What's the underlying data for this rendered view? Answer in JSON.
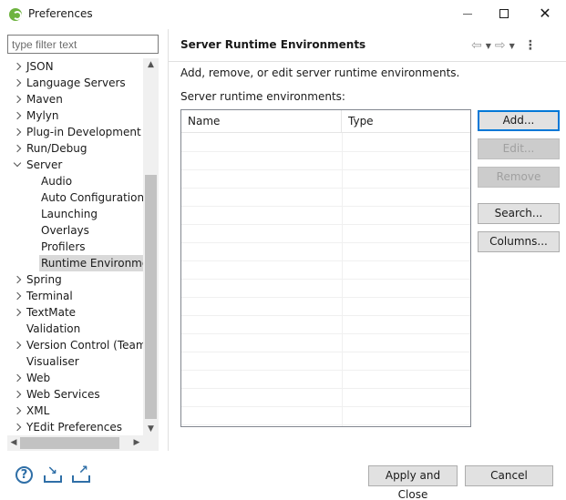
{
  "window": {
    "title": "Preferences",
    "minimize_label": "",
    "maximize_label": "",
    "close_label": "✕"
  },
  "sidebar": {
    "filter_placeholder": "type filter text",
    "items": [
      {
        "label": "JSON",
        "twisty": "collapsed",
        "level": 0
      },
      {
        "label": "Language Servers",
        "twisty": "collapsed",
        "level": 0
      },
      {
        "label": "Maven",
        "twisty": "collapsed",
        "level": 0
      },
      {
        "label": "Mylyn",
        "twisty": "collapsed",
        "level": 0
      },
      {
        "label": "Plug-in Development",
        "twisty": "collapsed",
        "level": 0
      },
      {
        "label": "Run/Debug",
        "twisty": "collapsed",
        "level": 0
      },
      {
        "label": "Server",
        "twisty": "expanded",
        "level": 0
      },
      {
        "label": "Audio",
        "twisty": "none",
        "level": 1
      },
      {
        "label": "Auto Configuration",
        "twisty": "none",
        "level": 1
      },
      {
        "label": "Launching",
        "twisty": "none",
        "level": 1
      },
      {
        "label": "Overlays",
        "twisty": "none",
        "level": 1
      },
      {
        "label": "Profilers",
        "twisty": "none",
        "level": 1
      },
      {
        "label": "Runtime Environmen",
        "twisty": "none",
        "level": 1,
        "selected": true
      },
      {
        "label": "Spring",
        "twisty": "collapsed",
        "level": 0
      },
      {
        "label": "Terminal",
        "twisty": "collapsed",
        "level": 0
      },
      {
        "label": "TextMate",
        "twisty": "collapsed",
        "level": 0
      },
      {
        "label": "Validation",
        "twisty": "none",
        "level": 0
      },
      {
        "label": "Version Control (Team)",
        "twisty": "collapsed",
        "level": 0
      },
      {
        "label": "Visualiser",
        "twisty": "none",
        "level": 0
      },
      {
        "label": "Web",
        "twisty": "collapsed",
        "level": 0
      },
      {
        "label": "Web Services",
        "twisty": "collapsed",
        "level": 0
      },
      {
        "label": "XML",
        "twisty": "collapsed",
        "level": 0
      },
      {
        "label": "YEdit Preferences",
        "twisty": "collapsed",
        "level": 0
      }
    ]
  },
  "page": {
    "title": "Server Runtime Environments",
    "description": "Add, remove, or edit server runtime environments.",
    "table_label": "Server runtime environments:",
    "table": {
      "columns": [
        "Name",
        "Type"
      ],
      "rows": []
    },
    "buttons": {
      "add": "Add...",
      "edit": "Edit...",
      "remove": "Remove",
      "search": "Search...",
      "columns": "Columns..."
    }
  },
  "footer": {
    "apply_close": "Apply and Close",
    "cancel": "Cancel"
  },
  "icons": {
    "app": "spring-leaf-icon",
    "back": "back-arrow-icon",
    "forward": "forward-arrow-icon",
    "menu": "view-menu-icon",
    "help": "help-icon",
    "import": "import-icon",
    "export": "export-icon"
  },
  "colors": {
    "accent": "#0078d7",
    "selection": "#d9d9d9",
    "spring": "#6db33f",
    "icon_blue": "#2f6fa7"
  }
}
